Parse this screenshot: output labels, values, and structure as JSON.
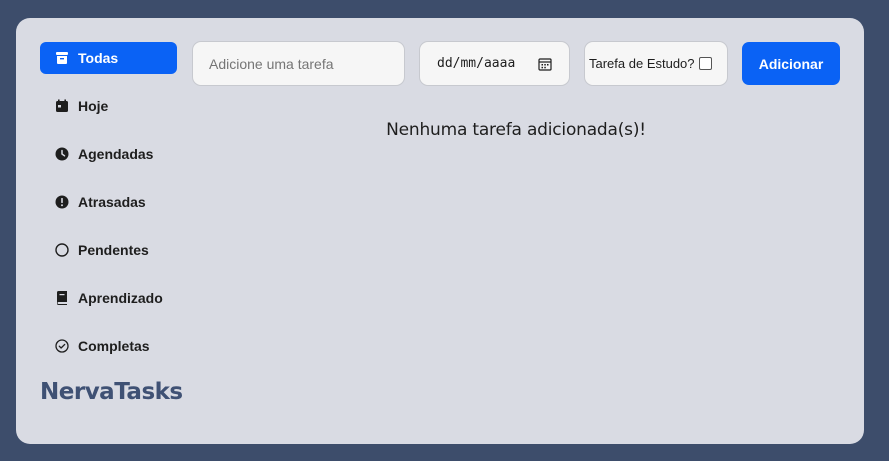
{
  "sidebar": {
    "items": [
      {
        "label": "Todas",
        "icon": "inbox-icon",
        "active": true
      },
      {
        "label": "Hoje",
        "icon": "calendar-icon",
        "active": false
      },
      {
        "label": "Agendadas",
        "icon": "clock-icon",
        "active": false
      },
      {
        "label": "Atrasadas",
        "icon": "exclamation-circle-icon",
        "active": false
      },
      {
        "label": "Pendentes",
        "icon": "circle-icon",
        "active": false
      },
      {
        "label": "Aprendizado",
        "icon": "book-icon",
        "active": false
      },
      {
        "label": "Completas",
        "icon": "check-circle-icon",
        "active": false
      }
    ],
    "brand": "NervaTasks"
  },
  "toolbar": {
    "task_placeholder": "Adicione uma tarefa",
    "date_value": "dd/mm/aaaa",
    "study_label": "Tarefa de Estudo?",
    "study_checked": false,
    "add_label": "Adicionar"
  },
  "main": {
    "empty_message": "Nenhuma tarefa adicionada(s)!"
  },
  "colors": {
    "background": "#3d4d6b",
    "card": "#d9dbe3",
    "accent": "#0a62f5",
    "brand": "#3f5174"
  }
}
